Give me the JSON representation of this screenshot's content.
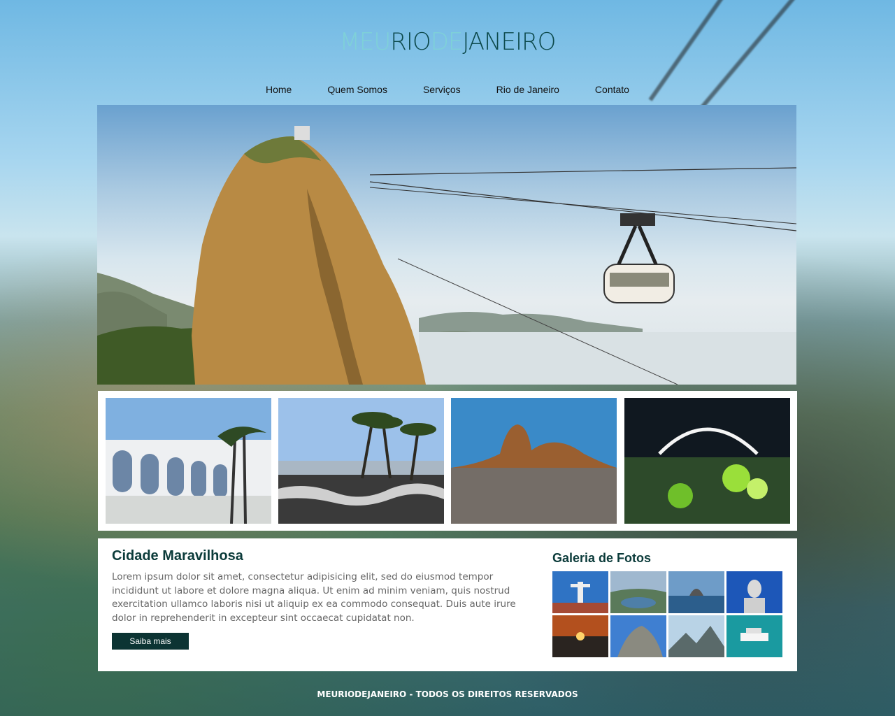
{
  "logo": {
    "part1": "MEU",
    "part2": "RIO",
    "part3": "DE",
    "part4": "JANEIRO",
    "colors": {
      "light": "#7fd1d8",
      "dark": "#0d4a4c"
    }
  },
  "nav": {
    "items": [
      {
        "label": "Home"
      },
      {
        "label": "Quem Somos"
      },
      {
        "label": "Serviços"
      },
      {
        "label": "Rio de Janeiro"
      },
      {
        "label": "Contato"
      }
    ]
  },
  "hero": {
    "icon": "sugarloaf-cable-car-photo"
  },
  "thumbnails": [
    {
      "icon": "arcos-da-lapa-photo"
    },
    {
      "icon": "copacabana-palm-trees-photo"
    },
    {
      "icon": "sugarloaf-bay-photo"
    },
    {
      "icon": "sambodromo-carnival-photo"
    }
  ],
  "article": {
    "title": "Cidade Maravilhosa",
    "body": "Lorem ipsum dolor sit amet, consectetur adipisicing elit, sed do eiusmod tempor incididunt ut labore et dolore magna aliqua. Ut enim ad minim veniam, quis nostrud exercitation ullamco laboris nisi ut aliquip ex ea commodo consequat. Duis aute irure dolor in reprehenderit in  excepteur sint occaecat cupidatat non.",
    "button_label": "Saiba mais"
  },
  "gallery": {
    "title": "Galeria de Fotos",
    "photos": [
      {
        "icon": "christ-redeemer-photo"
      },
      {
        "icon": "aerial-city-photo"
      },
      {
        "icon": "bay-view-photo"
      },
      {
        "icon": "christ-statue-closeup-photo"
      },
      {
        "icon": "sunset-photo"
      },
      {
        "icon": "rock-mountain-photo"
      },
      {
        "icon": "mountain-view-photo"
      },
      {
        "icon": "boat-photo"
      }
    ]
  },
  "footer": {
    "text": "MEURIODEJANEIRO - TODOS OS DIREITOS RESERVADOS"
  },
  "colors": {
    "accent": "#0c3433",
    "heading": "#0b3b3a"
  }
}
